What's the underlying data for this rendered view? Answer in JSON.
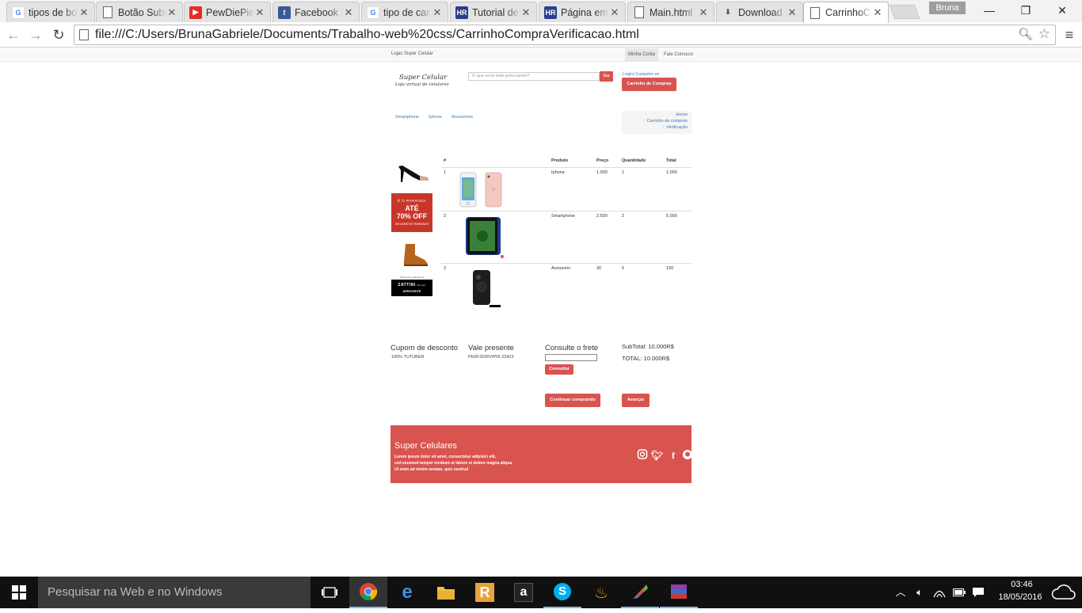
{
  "browser": {
    "tabs": [
      {
        "title": "tipos de bo",
        "icon": "google-icon"
      },
      {
        "title": "Botão Subr",
        "icon": "document-icon"
      },
      {
        "title": "PewDiePie",
        "icon": "youtube-icon"
      },
      {
        "title": "Facebook",
        "icon": "facebook-icon"
      },
      {
        "title": "tipo de car",
        "icon": "google-icon"
      },
      {
        "title": "Tutorial de",
        "icon": "hr-icon"
      },
      {
        "title": "Página em",
        "icon": "hr-icon"
      },
      {
        "title": "Main.html",
        "icon": "document-icon"
      },
      {
        "title": "Download",
        "icon": "download-icon"
      },
      {
        "title": "CarrinhoC",
        "icon": "document-icon",
        "active": true
      }
    ],
    "profile_name": "Bruna",
    "url": "file:///C:/Users/BrunaGabriele/Documents/Trabalho-web%20css/CarrinhoCompraVerificacao.html"
  },
  "page": {
    "topbar": {
      "brand": "Lojas Super Celular",
      "nav": [
        {
          "label": "Minha Conta"
        },
        {
          "label": "Fale Conosco"
        }
      ]
    },
    "header": {
      "logo_title": "Super Celular",
      "logo_subtitle": "Loja virtual de celulares",
      "search_placeholder": "O que você está procurando?",
      "search_button": "Go",
      "login_link": "Login| Cadastre-se",
      "cart_button": "Carrinho de Compras"
    },
    "categories": [
      "Smartphone",
      "Iphone",
      "Acessórios"
    ],
    "breadcrumb": [
      "Home",
      "Carrinho de compras",
      "Verificação"
    ],
    "ads": {
      "promo": {
        "line1": "É O PARAÍSO!",
        "line2": "ATÉ",
        "line3": "70% OFF",
        "line4": "EM SAPATOS FEMININOS"
      },
      "zattini": {
        "top": "Mantenha a Elegância",
        "brand": "ZATTINI",
        "brand_suffix": "Outlet",
        "cta": "APROVEITE"
      }
    },
    "cart": {
      "headers": [
        "#",
        "Produto",
        "Preço",
        "Quantidade",
        "Total"
      ],
      "rows": [
        {
          "num": "1",
          "product": "Iphone",
          "price": "1.000",
          "qty": "1",
          "total": "1.000"
        },
        {
          "num": "2",
          "product": "Smartphone",
          "price": "2.500",
          "qty": "2",
          "total": "5.000"
        },
        {
          "num": "3",
          "product": "Acessorio",
          "price": "30",
          "qty": "5",
          "total": "150"
        }
      ]
    },
    "summary": {
      "coupon_title": "Cupom de desconto",
      "coupon_code": "100% TUTUBER",
      "gift_title": "Vale presente",
      "gift_code": "PEKFSORVIPIN 23423",
      "shipping_title": "Consulte o frete",
      "shipping_button": "Consultar",
      "subtotal": "SubTotal: 10.000R$",
      "total": "TOTAL: 10.000R$",
      "continue_button": "Continuar comprando",
      "next_button": "Avançar"
    },
    "footer": {
      "title": "Super Celulares",
      "text_lines": [
        "Lorem ipsum dolor sit amet, consectetur adipisici elit,",
        "sed eiusmod tempor incidunt ut labore et dolore magna aliqua.",
        "Ut enim ad minim veniam, quis nostrud"
      ],
      "social": [
        "instagram-icon",
        "twitter-icon",
        "facebook-icon",
        "github-icon"
      ]
    }
  },
  "taskbar": {
    "search_placeholder": "Pesquisar na Web e no Windows",
    "time": "03:46",
    "date": "18/05/2016",
    "apps": [
      "task-view-icon",
      "chrome-icon",
      "edge-icon",
      "file-explorer-icon",
      "r-app-icon",
      "amazon-icon",
      "skype-icon",
      "fire-app-icon",
      "feather-app-icon",
      "rar-app-icon"
    ]
  },
  "colors": {
    "accent": "#d9534f",
    "link": "#337ab7"
  }
}
